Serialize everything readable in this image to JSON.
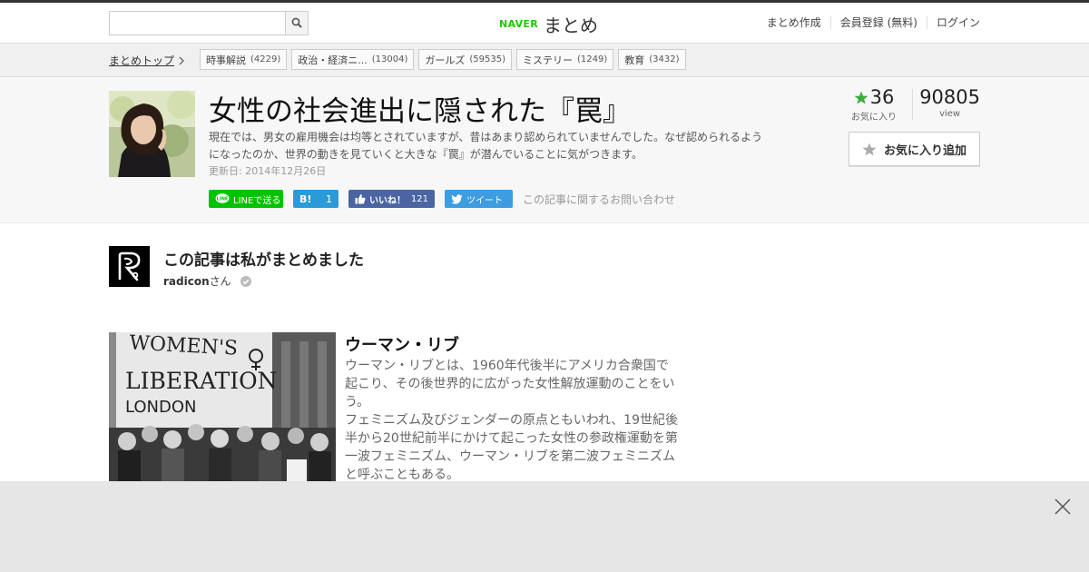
{
  "header": {
    "search": {
      "value": "",
      "placeholder": ""
    },
    "logo": {
      "brand": "NAVER",
      "service": "まとめ"
    },
    "nav": [
      "まとめ作成",
      "会員登録 (無料)",
      "ログイン"
    ]
  },
  "categories": {
    "breadcrumb": "まとめトップ",
    "items": [
      {
        "label": "時事解説",
        "count": "(4229)"
      },
      {
        "label": "政治・経済ニ...",
        "count": "(13004)"
      },
      {
        "label": "ガールズ",
        "count": "(59535)"
      },
      {
        "label": "ミステリー",
        "count": "(1249)"
      },
      {
        "label": "教育",
        "count": "(3432)"
      }
    ]
  },
  "article": {
    "title": "女性の社会進出に隠された『罠』",
    "description": "現在では、男女の雇用機会は均等とされていますが、昔はあまり認められていませんでした。なぜ認められるようになったのか、世界の動きを見ていくと大きな『罠』が潜んでいることに気がつきます。",
    "updated": "更新日: 2014年12月26日",
    "favorites": {
      "count": "36",
      "label": "お気に入り"
    },
    "views": {
      "count": "90805",
      "label": "view"
    },
    "add_favorite": "お気に入り追加",
    "share": {
      "line": "LINEで送る",
      "hatena": "1",
      "hatena_icon": "B!",
      "facebook": "いいね！",
      "facebook_count": "121",
      "twitter": "ツイート",
      "inquiry": "この記事に関するお問い合わせ"
    }
  },
  "curator": {
    "heading": "この記事は私がまとめました",
    "name": "radicon",
    "suffix": "さん"
  },
  "item": {
    "title": "ウーマン・リブ",
    "paragraphs": [
      "ウーマン・リブとは、1960年代後半にアメリカ合衆国で起こり、その後世界的に広がった女性解放運動のことをいう。",
      "フェミニズム及びジェンダーの原点ともいわれ、19世紀後半から20世紀前半にかけて起こった女性の参政権運動を第一波フェミニズム、ウーマン・リブを第二波フェミニズムと呼ぶこともある。"
    ],
    "photo_banner": [
      "WOMEN'S",
      "LIBERATION",
      "LONDON"
    ]
  },
  "colors": {
    "naver_green": "#1ec800",
    "line": "#00c300",
    "hatena": "#2a9bd8",
    "facebook": "#4a65a2",
    "twitter": "#3d9de0",
    "star": "#3dad3d"
  },
  "icons": [
    "search-icon",
    "chevron-right-icon",
    "star-icon",
    "line-icon",
    "thumbs-up-icon",
    "twitter-bird-icon",
    "verified-check-icon",
    "close-icon"
  ]
}
